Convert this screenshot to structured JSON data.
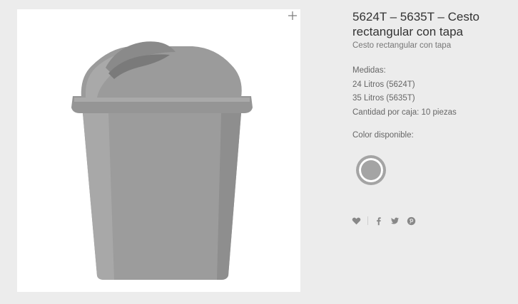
{
  "product": {
    "title": "5624T – 5635T – Cesto rectangular con tapa",
    "subtitle": "Cesto rectangular con tapa"
  },
  "specs": {
    "heading": "Medidas:",
    "line1": "24 Litros (5624T)",
    "line2": "35 Litros (5635T)",
    "line3": "Cantidad por caja: 10 piezas"
  },
  "colors": {
    "label": "Color disponible:",
    "swatch": "#a4a4a4"
  },
  "icons": {
    "zoom": "plus-icon",
    "wishlist": "heart-icon",
    "facebook": "facebook-icon",
    "twitter": "twitter-icon",
    "pinterest": "pinterest-icon"
  }
}
